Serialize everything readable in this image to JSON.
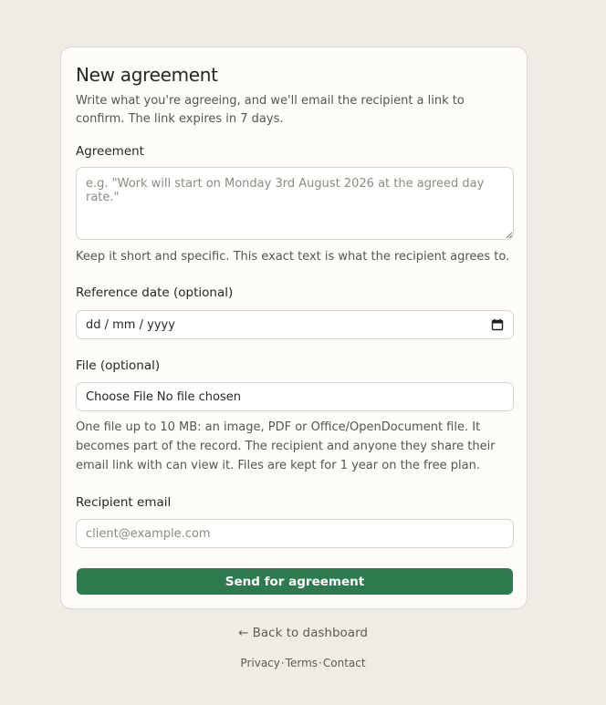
{
  "form": {
    "title": "New agreement",
    "intro": "Write what you're agreeing, and we'll email the recipient a link to confirm. The link expires in 7 days.",
    "agreement": {
      "label": "Agreement",
      "placeholder": "e.g. \"Work will start on Monday 3rd August 2026 at the agreed day rate.\"",
      "value": "",
      "help": "Keep it short and specific. This exact text is what the recipient agrees to."
    },
    "reference_date": {
      "label": "Reference date (optional)",
      "placeholder": "dd / mm / yyyy",
      "icon": "calendar-icon"
    },
    "file": {
      "label": "File (optional)",
      "button_label": "Choose File",
      "status": "No file chosen",
      "help": "One file up to 10 MB: an image, PDF or Office/OpenDocument file. It becomes part of the record. The recipient and anyone they share their email link with can view it. Files are kept for 1 year on the free plan."
    },
    "recipient_email": {
      "label": "Recipient email",
      "placeholder": "client@example.com",
      "value": ""
    },
    "submit_label": "Send for agreement"
  },
  "nav": {
    "back_label": "← Back to dashboard"
  },
  "footer": {
    "links": [
      "Privacy",
      "Terms",
      "Contact"
    ],
    "separator": "·"
  },
  "colors": {
    "background": "#efebe5",
    "card": "#fdfcf8",
    "accent": "#2d7a4f"
  }
}
